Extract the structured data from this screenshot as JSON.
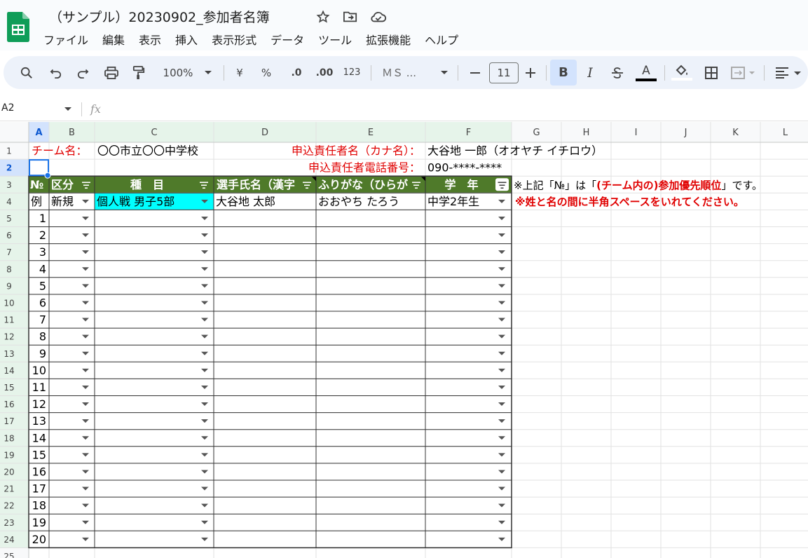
{
  "doc": {
    "title": "（サンプル）20230902_参加者名簿"
  },
  "menu": [
    "ファイル",
    "編集",
    "表示",
    "挿入",
    "表示形式",
    "データ",
    "ツール",
    "拡張機能",
    "ヘルプ"
  ],
  "toolbar": {
    "zoom": "100%",
    "currency": "¥",
    "percent": "%",
    "dec_decrease": ".0",
    "dec_increase": ".00",
    "number_format": "123",
    "font": "ＭＳ ...",
    "font_size": "11",
    "bold": "B",
    "italic": "I",
    "text_color": "A"
  },
  "namebox": "A2",
  "fx": "fx",
  "columns": [
    "A",
    "B",
    "C",
    "D",
    "E",
    "F",
    "G",
    "H",
    "I",
    "J",
    "K",
    "L"
  ],
  "row_numbers": [
    "1",
    "2",
    "3",
    "4",
    "5",
    "6",
    "7",
    "8",
    "9",
    "10",
    "11",
    "12",
    "13",
    "14",
    "15",
    "16",
    "17",
    "18",
    "19",
    "20",
    "21",
    "22",
    "23",
    "24",
    "25"
  ],
  "sheet": {
    "row1": {
      "team_label": "チーム名：",
      "team_value": "〇〇市立〇〇中学校",
      "resp_label": "申込責任者名（カナ名）：",
      "resp_value": "大谷地 一郎（オオヤチ イチロウ）"
    },
    "row2": {
      "phone_label": "申込責任者電話番号：",
      "phone_value": "090-****-****"
    },
    "headers": [
      "№",
      "区分",
      "種　目",
      "選手氏名（漢字",
      "ふりがな（ひらが",
      "学　年"
    ],
    "note1_a": "※上記「№」は「",
    "note1_b": "(チーム内の)参加優先順位",
    "note1_c": "」です。",
    "note2": "※姓と名の間に半角スペースをいれてください。",
    "example": {
      "no": "例",
      "category": "新規",
      "event": "個人戦 男子5部",
      "name": "大谷地 太郎",
      "furigana": "おおやち たろう",
      "grade": "中学2年生"
    },
    "entry_numbers": [
      "1",
      "2",
      "3",
      "4",
      "5",
      "6",
      "7",
      "8",
      "9",
      "10",
      "11",
      "12",
      "13",
      "14",
      "15",
      "16",
      "17",
      "18",
      "19",
      "20"
    ]
  },
  "colors": {
    "header_green": "#4f7a2a",
    "accent_red": "#e00000",
    "cyan": "#00ffff",
    "selection_blue": "#1a73e8"
  }
}
